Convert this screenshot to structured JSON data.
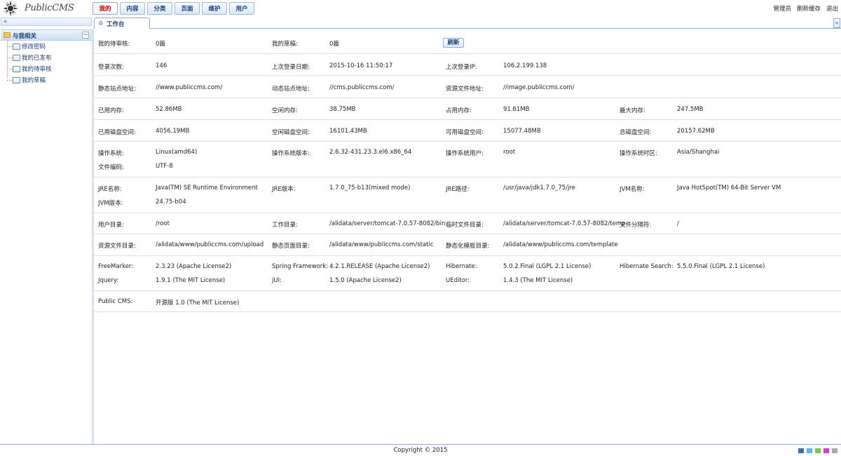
{
  "app": {
    "logo_text": "PublicCMS"
  },
  "nav": {
    "tabs": [
      {
        "label": "我的",
        "active": true
      },
      {
        "label": "内容"
      },
      {
        "label": "分类"
      },
      {
        "label": "页面"
      },
      {
        "label": "维护"
      },
      {
        "label": "用户"
      }
    ]
  },
  "user_links": {
    "admin": "管理员",
    "refresh_cache": "刷新缓存",
    "logout": "退出"
  },
  "sidebar": {
    "toggle_icon": "«",
    "panel_title": "与我相关",
    "collapse_icon": "−",
    "items": [
      {
        "label": "修改密码"
      },
      {
        "label": "我的已发布"
      },
      {
        "label": "我的待审核"
      },
      {
        "label": "我的草稿"
      }
    ]
  },
  "main_tab": {
    "home_icon": "⌂",
    "label": "工作台",
    "scroll_icon": "»"
  },
  "refresh_button": "刷新",
  "info": {
    "pending_review_label": "我的待审核:",
    "pending_review_value": "0篇",
    "drafts_label": "我的草稿:",
    "drafts_value": "0篇",
    "login_count_label": "登录次数:",
    "login_count_value": "146",
    "last_login_date_label": "上次登录日期:",
    "last_login_date_value": "2015-10-16 11:50:17",
    "last_login_ip_label": "上次登录IP:",
    "last_login_ip_value": "106.2.199.138",
    "static_site_label": "静态站点地址:",
    "static_site_value": "//www.publiccms.com/",
    "dynamic_site_label": "动态站点地址:",
    "dynamic_site_value": "//cms.publiccms.com/",
    "resource_url_label": "资源文件地址:",
    "resource_url_value": "//image.publiccms.com/",
    "used_mem_label": "已用内存:",
    "used_mem_value": "52.86MB",
    "free_mem_label": "空闲内存:",
    "free_mem_value": "38.75MB",
    "occupied_mem_label": "占用内存:",
    "occupied_mem_value": "91.61MB",
    "max_mem_label": "最大内存:",
    "max_mem_value": "247.5MB",
    "used_disk_label": "已用磁盘空间:",
    "used_disk_value": "4056.19MB",
    "free_disk_label": "空闲磁盘空间:",
    "free_disk_value": "16101.43MB",
    "usable_disk_label": "可用磁盘空间:",
    "usable_disk_value": "15077.48MB",
    "total_disk_label": "总磁盘空间:",
    "total_disk_value": "20157.62MB",
    "os_label": "操作系统:",
    "os_value": "Linux(amd64)",
    "os_version_label": "操作系统版本:",
    "os_version_value": "2.6.32-431.23.3.el6.x86_64",
    "os_user_label": "操作系统用户:",
    "os_user_value": "root",
    "os_tz_label": "操作系统时区:",
    "os_tz_value": "Asia/Shanghai",
    "encoding_label": "文件编码:",
    "encoding_value": "UTF-8",
    "jre_name_label": "JRE名称:",
    "jre_name_value": "Java(TM) SE Runtime Environment",
    "jre_version_label": "JRE版本:",
    "jre_version_value": "1.7.0_75-b13(mixed mode)",
    "jre_path_label": "JRE路径:",
    "jre_path_value": "/usr/java/jdk1.7.0_75/jre",
    "jvm_name_label": "JVM名称:",
    "jvm_name_value": "Java HotSpot(TM) 64-Bit Server VM",
    "jvm_version_label": "JVM版本:",
    "jvm_version_value": "24.75-b04",
    "user_dir_label": "用户目录:",
    "user_dir_value": "/root",
    "work_dir_label": "工作目录:",
    "work_dir_value": "/alidata/server/tomcat-7.0.57-8082/bin",
    "temp_dir_label": "临时文件目录:",
    "temp_dir_value": "/alidata/server/tomcat-7.0.57-8082/temp",
    "file_sep_label": "文件分隔符:",
    "file_sep_value": "/",
    "res_dir_label": "资源文件目录:",
    "res_dir_value": "/alidata/www/publiccms.com/upload",
    "static_dir_label": "静态页面目录:",
    "static_dir_value": "/alidata/www/publiccms.com/static",
    "tpl_dir_label": "静态化模板目录:",
    "tpl_dir_value": "/alidata/www/publiccms.com/template",
    "freemarker_label": "FreeMarker:",
    "freemarker_value": "2.3.23 (Apache License2)",
    "spring_label": "Spring Framework:",
    "spring_value": "4.2.1.RELEASE (Apache License2)",
    "hibernate_label": "Hibernate:",
    "hibernate_value": "5.0.2.Final (LGPL 2.1 License)",
    "hsearch_label": "Hibernate Search:",
    "hsearch_value": "5.5.0.Final (LGPL 2.1 License)",
    "jquery_label": "Jquery:",
    "jquery_value": "1.9.1 (The MIT License)",
    "jui_label": "jUI:",
    "jui_value": "1.5.0 (Apache License2)",
    "ueditor_label": "UEditor:",
    "ueditor_value": "1.4.3 (The MIT License)",
    "publiccms_label": "Public CMS:",
    "publiccms_value": "开源版 1.0 (The MIT License)"
  },
  "footer": {
    "copyright": "Copyright © 2015"
  },
  "themes": {
    "colors": [
      "#3a6fb6",
      "#5bb5e8",
      "#7ac943",
      "#d93ad0",
      "#a8a8a8"
    ]
  }
}
